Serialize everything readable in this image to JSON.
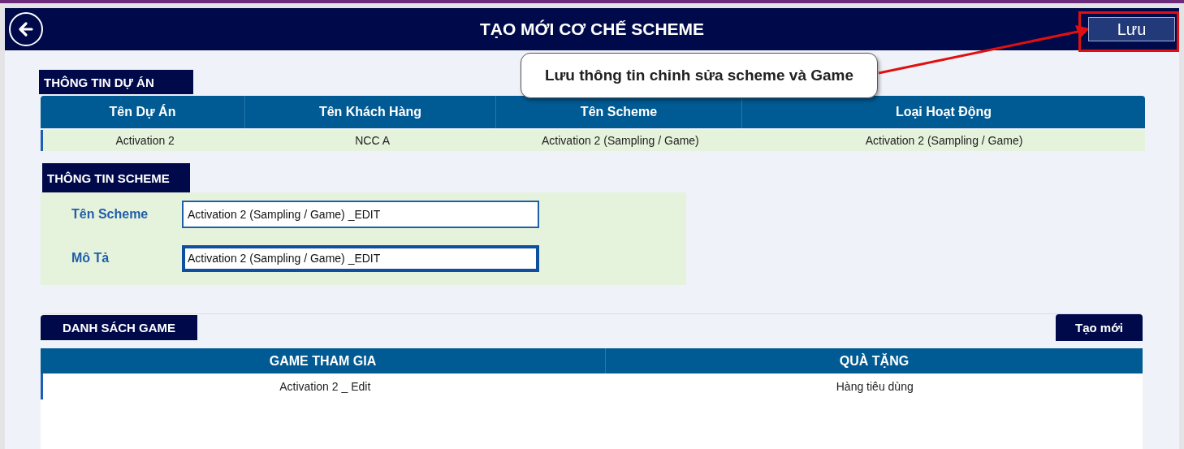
{
  "header": {
    "title": "TẠO MỚI CƠ CHẾ SCHEME",
    "save_button": "Lưu"
  },
  "callout": {
    "text": "Lưu thông tin chỉnh sửa scheme và Game"
  },
  "project_info": {
    "title": "THÔNG TIN DỰ ÁN",
    "columns": [
      "Tên Dự Án",
      "Tên Khách Hàng",
      "Tên Scheme",
      "Loại Hoạt Động"
    ],
    "rows": [
      {
        "cells": [
          "Activation 2",
          "NCC A",
          "Activation 2 (Sampling / Game)",
          "Activation 2 (Sampling / Game)"
        ],
        "selected": true
      }
    ]
  },
  "scheme_info": {
    "title": "THÔNG TIN SCHEME",
    "fields": [
      {
        "label": "Tên Scheme",
        "value": "Activation 2 (Sampling / Game) _EDIT",
        "focused": false
      },
      {
        "label": "Mô Tả",
        "value": "Activation 2 (Sampling / Game) _EDIT",
        "focused": true
      }
    ]
  },
  "game_list": {
    "title": "DANH SÁCH GAME",
    "new_button": "Tạo mới",
    "columns": [
      "GAME THAM GIA",
      "QUÀ TẶNG"
    ],
    "rows": [
      {
        "cells": [
          "Activation 2 _ Edit",
          "Hàng tiêu dùng"
        ],
        "selected": true
      }
    ]
  }
}
